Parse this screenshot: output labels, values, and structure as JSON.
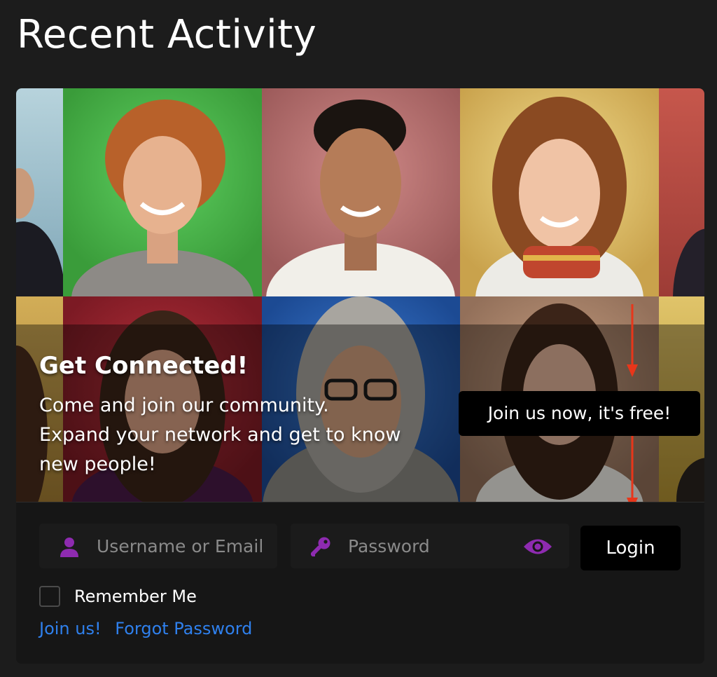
{
  "page": {
    "title": "Recent Activity"
  },
  "hero": {
    "title": "Get Connected!",
    "lines": [
      "Come and join our community.",
      "Expand your network and get to know",
      "new people!"
    ],
    "tooltip": "Join us now, it's free!"
  },
  "login_form": {
    "username_placeholder": "Username or Email",
    "password_placeholder": "Password",
    "login_label": "Login",
    "remember_label": "Remember Me",
    "join_link": "Join us!",
    "forgot_link": "Forgot Password"
  },
  "icons": {
    "username": "user-icon",
    "password": "key-icon",
    "show_password": "eye-icon"
  },
  "colors": {
    "background": "#1c1c1c",
    "card": "#161616",
    "accent_icon": "#8e2bb0",
    "link": "#2f80ed",
    "annotation_arrow": "#e8361a",
    "button": "#000000"
  }
}
